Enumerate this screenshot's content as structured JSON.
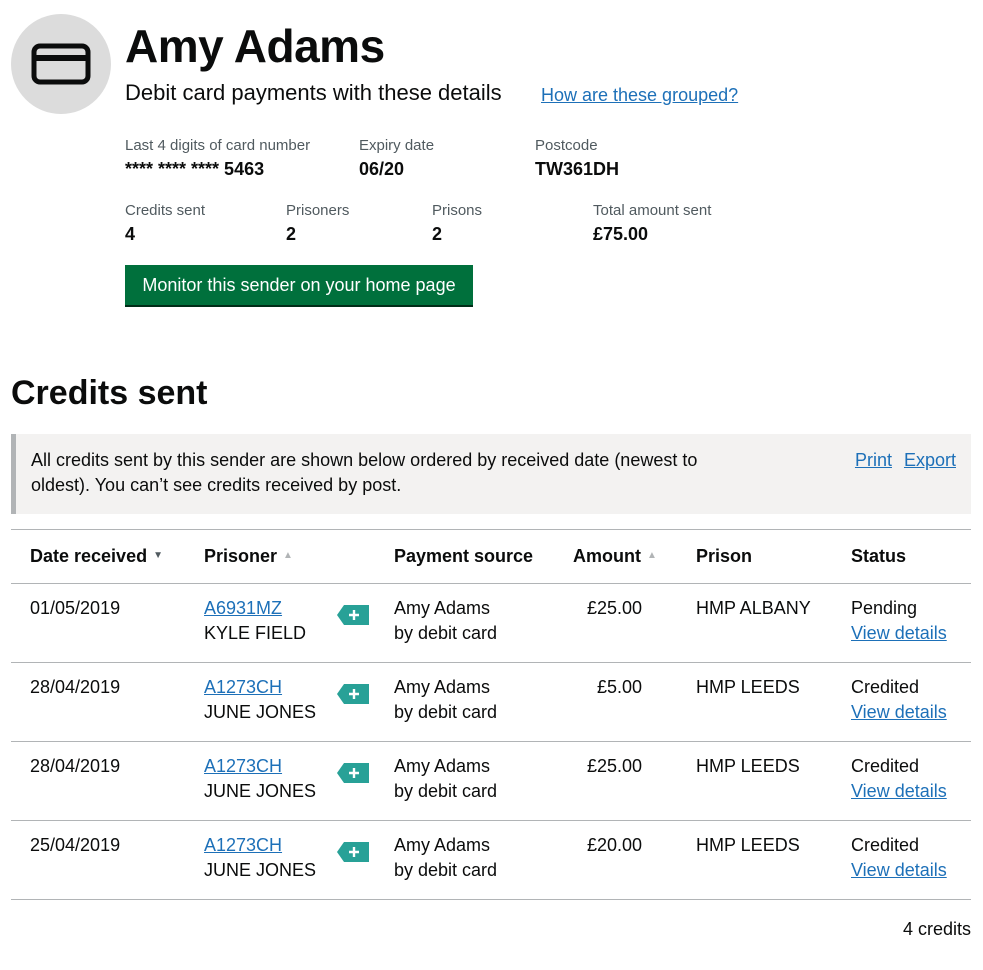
{
  "sender": {
    "name": "Amy Adams",
    "subtitle": "Debit card payments with these details",
    "grouped_link": "How are these grouped?",
    "icon": "debit-card-icon"
  },
  "card_details": {
    "last4_label": "Last 4 digits of card number",
    "last4_value": "**** **** **** 5463",
    "expiry_label": "Expiry date",
    "expiry_value": "06/20",
    "postcode_label": "Postcode",
    "postcode_value": "TW361DH"
  },
  "summary": {
    "credits_label": "Credits sent",
    "credits_value": "4",
    "prisoners_label": "Prisoners",
    "prisoners_value": "2",
    "prisons_label": "Prisons",
    "prisons_value": "2",
    "total_label": "Total amount sent",
    "total_value": "£75.00"
  },
  "monitor_button": "Monitor this sender on your home page",
  "credits_section": {
    "title": "Credits sent",
    "notice": "All credits sent by this sender are shown below ordered by received date (newest to oldest). You can’t see credits received by post.",
    "print_link": "Print",
    "export_link": "Export"
  },
  "table": {
    "headers": {
      "date": "Date received",
      "prisoner": "Prisoner",
      "source": "Payment source",
      "amount": "Amount",
      "prison": "Prison",
      "status": "Status"
    },
    "rows": [
      {
        "date": "01/05/2019",
        "prisoner_number": "A6931MZ",
        "prisoner_name": "KYLE FIELD",
        "source_name": "Amy Adams",
        "source_method": "by debit card",
        "amount": "£25.00",
        "prison": "HMP ALBANY",
        "status": "Pending",
        "details_link": "View details"
      },
      {
        "date": "28/04/2019",
        "prisoner_number": "A1273CH",
        "prisoner_name": "JUNE JONES",
        "source_name": "Amy Adams",
        "source_method": "by debit card",
        "amount": "£5.00",
        "prison": "HMP LEEDS",
        "status": "Credited",
        "details_link": "View details"
      },
      {
        "date": "28/04/2019",
        "prisoner_number": "A1273CH",
        "prisoner_name": "JUNE JONES",
        "source_name": "Amy Adams",
        "source_method": "by debit card",
        "amount": "£25.00",
        "prison": "HMP LEEDS",
        "status": "Credited",
        "details_link": "View details"
      },
      {
        "date": "25/04/2019",
        "prisoner_number": "A1273CH",
        "prisoner_name": "JUNE JONES",
        "source_name": "Amy Adams",
        "source_method": "by debit card",
        "amount": "£20.00",
        "prison": "HMP LEEDS",
        "status": "Credited",
        "details_link": "View details"
      }
    ],
    "count": "4 credits"
  },
  "colors": {
    "link": "#1d70b8",
    "button": "#00703c",
    "tag": "#28a197",
    "avatar_bg": "#dcdcdc"
  }
}
